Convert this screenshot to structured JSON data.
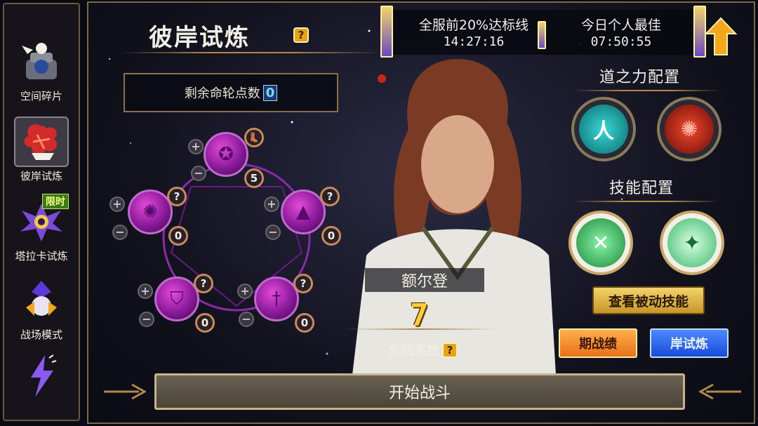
{
  "sidebar": {
    "items": [
      {
        "label": "空间碎片",
        "icon": "space-fragment-icon"
      },
      {
        "label": "彼岸试炼",
        "icon": "red-flower-icon"
      },
      {
        "label": "塔拉卡试炼",
        "icon": "winged-emblem-icon",
        "badge": "限时"
      },
      {
        "label": "战场模式",
        "icon": "battlefield-crystal-icon"
      },
      {
        "label": "",
        "icon": "lightning-icon"
      }
    ]
  },
  "header": {
    "title": "彼岸试炼",
    "help": "?"
  },
  "points": {
    "label": "剩余命轮点数",
    "value": "0"
  },
  "stats": {
    "server_label": "全服前20%达标线",
    "server_time": "14:27:16",
    "personal_label": "今日个人最佳",
    "personal_time": "07:50:55"
  },
  "wheel": {
    "nodes": [
      {
        "id": "top",
        "level": "5",
        "badge_icon": "boot-icon"
      },
      {
        "id": "left",
        "level": "0",
        "badge": "?"
      },
      {
        "id": "right",
        "level": "0",
        "badge": "?"
      },
      {
        "id": "bottom-left",
        "level": "0",
        "badge": "?"
      },
      {
        "id": "bottom-right",
        "level": "0",
        "badge": "?"
      }
    ],
    "plus": "+",
    "minus": "−"
  },
  "hero": {
    "name": "额尔登",
    "danger_value": "7",
    "danger_label": "危险系数",
    "danger_help": "?"
  },
  "right_panel": {
    "dao_title": "道之力配置",
    "skill_title": "技能配置",
    "dao_orbs": [
      {
        "glyph": "人",
        "color": "#1fa8a8",
        "icon": "human-glyph-icon"
      },
      {
        "glyph": "✺",
        "color": "#c8281a",
        "icon": "flame-rune-icon"
      }
    ],
    "skill_orbs": [
      {
        "glyph": "✕",
        "color": "#2ab84a",
        "icon": "crossed-blades-icon"
      },
      {
        "glyph": "✦",
        "color": "#3ac86a",
        "icon": "arrow-rain-icon"
      }
    ],
    "passive_button": "查看被动技能",
    "tab_left": "期战绩",
    "tab_right": "岸试炼"
  },
  "start_button": "开始战斗",
  "colors": {
    "gold_border": "#b08a4a",
    "accent_purple": "#c06ad0",
    "orange": "#e8701a",
    "blue": "#1a4ad8"
  }
}
